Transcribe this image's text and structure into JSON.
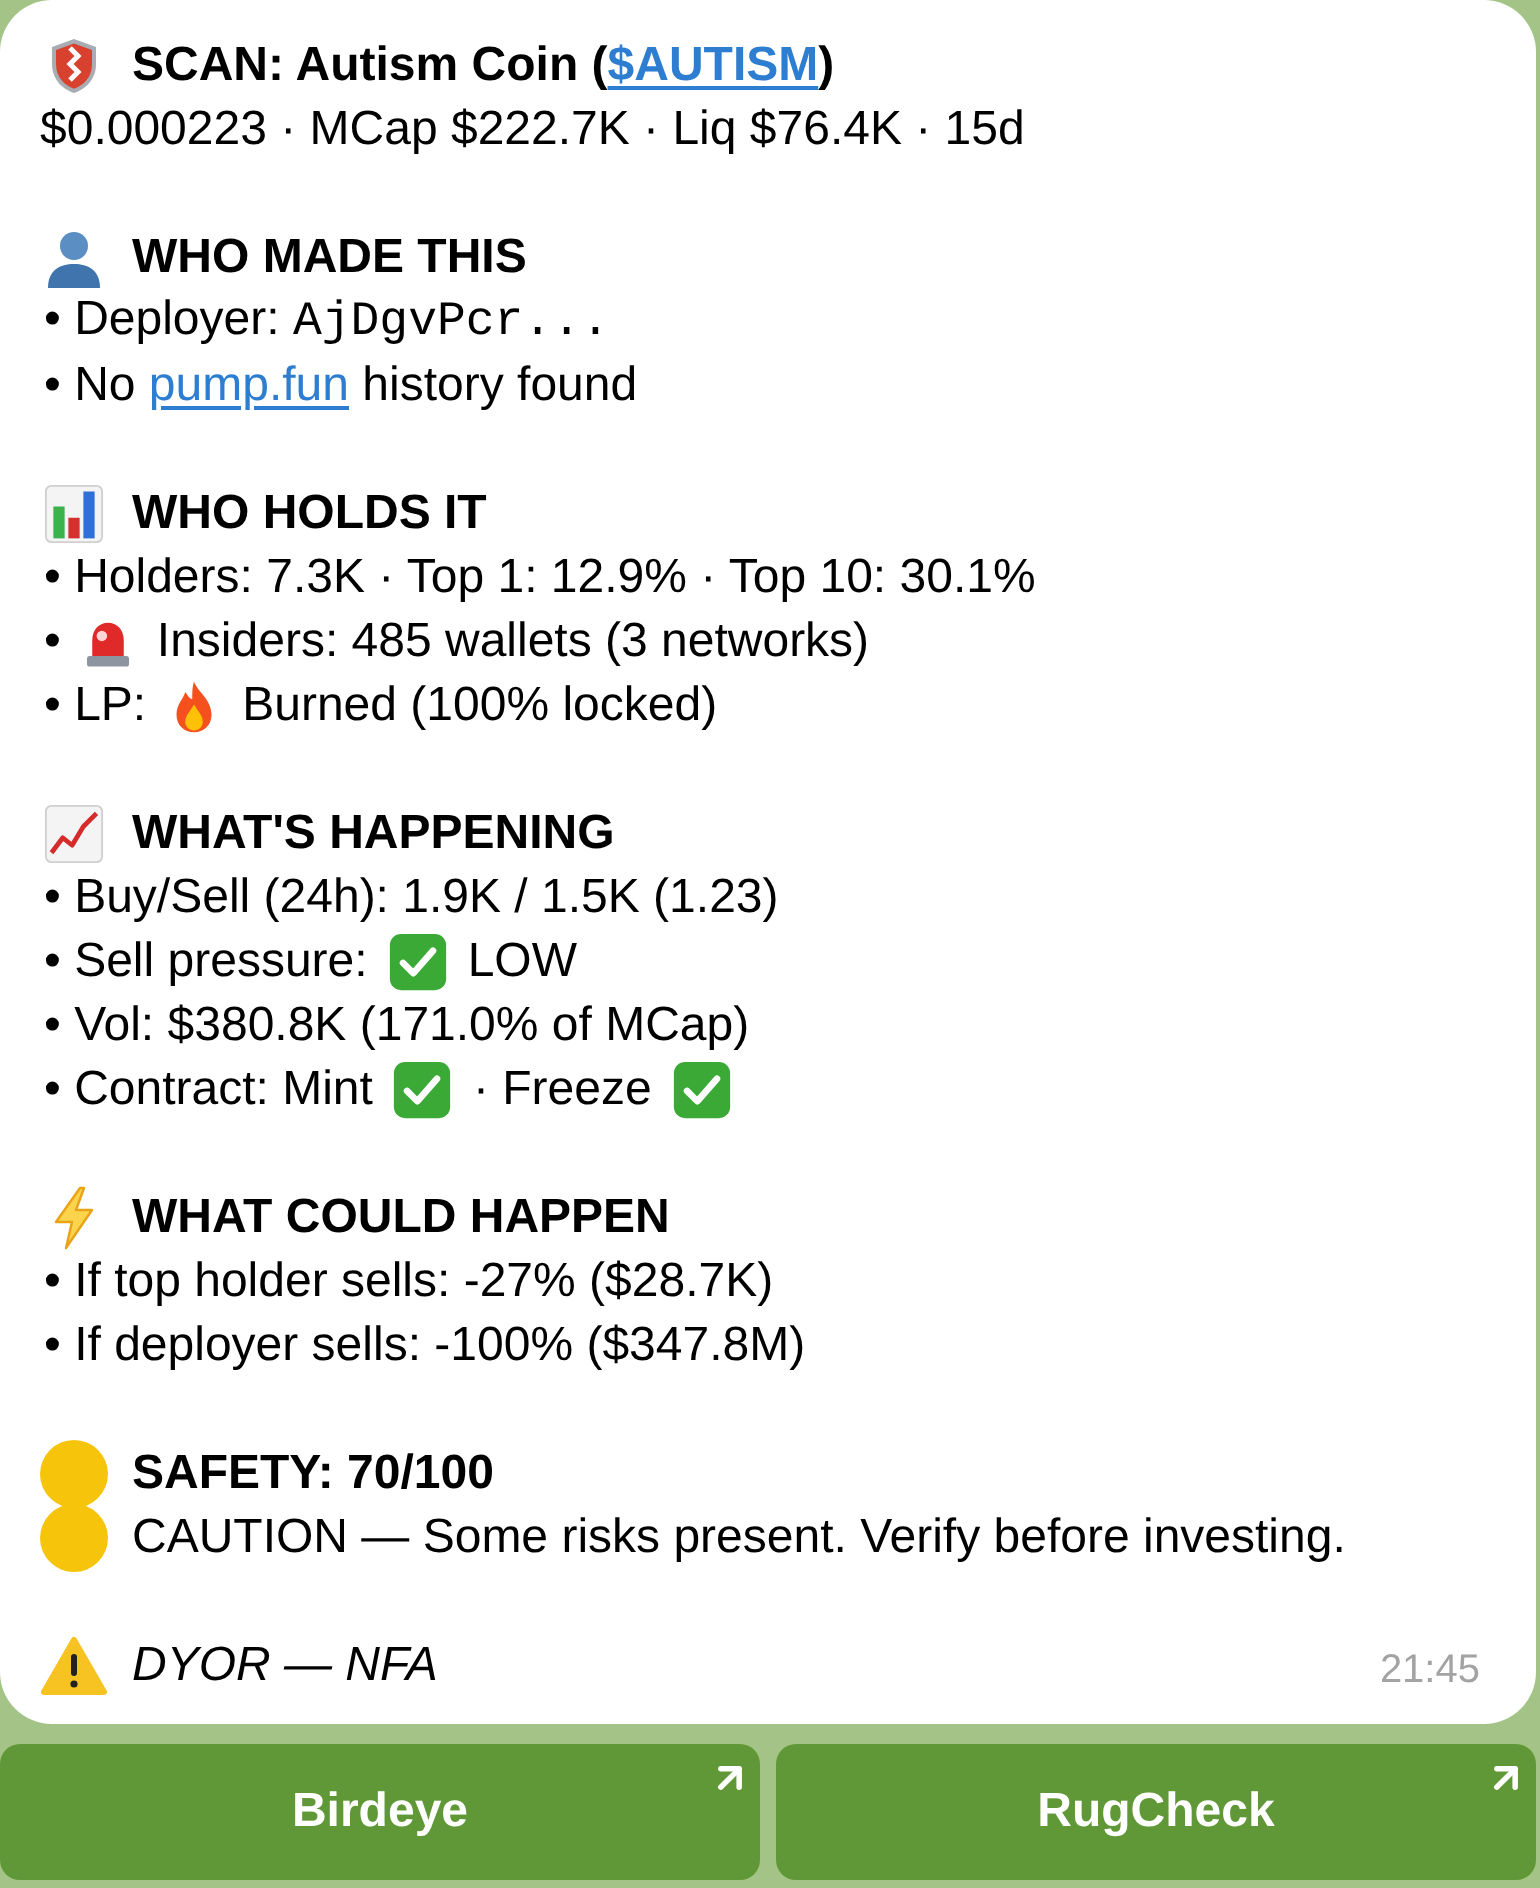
{
  "message": {
    "header": {
      "kind": "scan",
      "title": [
        {
          "kind": "text",
          "text": "SCAN: Autism Coin ("
        },
        {
          "kind": "link",
          "text": "$AUTISM"
        },
        {
          "kind": "text",
          "text": ")"
        }
      ],
      "stats": "$0.000223 · MCap $222.7K · Liq $76.4K · 15d"
    },
    "sections": [
      {
        "kind": "creator",
        "heading": "WHO MADE THIS",
        "lines": [
          [
            {
              "kind": "text",
              "text": "• Deployer: "
            },
            {
              "kind": "code",
              "text": "AjDgvPcr..."
            }
          ],
          [
            {
              "kind": "text",
              "text": "• No "
            },
            {
              "kind": "link",
              "text": "pump.fun"
            },
            {
              "kind": "text",
              "text": " history found"
            }
          ]
        ]
      },
      {
        "kind": "holders",
        "heading": "WHO HOLDS IT",
        "lines": [
          [
            {
              "kind": "text",
              "text": "• Holders: 7.3K · Top 1: 12.9% · Top 10: 30.1%"
            }
          ],
          [
            {
              "kind": "text",
              "text": "•"
            },
            {
              "kind": "alert"
            },
            {
              "kind": "text",
              "text": "Insiders: 485 wallets (3 networks)"
            }
          ],
          [
            {
              "kind": "text",
              "text": "• LP:"
            },
            {
              "kind": "burn"
            },
            {
              "kind": "text",
              "text": "Burned (100% locked)"
            }
          ]
        ]
      },
      {
        "kind": "activity",
        "heading": "WHAT'S HAPPENING",
        "lines": [
          [
            {
              "kind": "text",
              "text": "• Buy/Sell (24h): 1.9K / 1.5K (1.23)"
            }
          ],
          [
            {
              "kind": "text",
              "text": "• Sell pressure:"
            },
            {
              "kind": "ok"
            },
            {
              "kind": "text",
              "text": "LOW"
            }
          ],
          [
            {
              "kind": "text",
              "text": "• Vol: $380.8K (171.0% of MCap)"
            }
          ],
          [
            {
              "kind": "text",
              "text": "• Contract: Mint"
            },
            {
              "kind": "ok"
            },
            {
              "kind": "text",
              "text": "· Freeze"
            },
            {
              "kind": "ok"
            }
          ]
        ]
      },
      {
        "kind": "risk",
        "heading": "WHAT COULD HAPPEN",
        "lines": [
          [
            {
              "kind": "text",
              "text": "• If top holder sells: -27% ($28.7K)"
            }
          ],
          [
            {
              "kind": "text",
              "text": "• If deployer sells: -100% ($347.8M)"
            }
          ]
        ]
      },
      {
        "kind": "safety",
        "color": "#f7c40c",
        "heading": "SAFETY: 70/100",
        "lines": [
          [
            {
              "kind": "status"
            },
            {
              "kind": "text",
              "text": "CAUTION — Some risks present. Verify before investing."
            }
          ]
        ]
      }
    ],
    "footer": {
      "kind": "warning",
      "text": "DYOR — NFA"
    },
    "time": "21:45"
  },
  "buttons": [
    {
      "label": "Birdeye"
    },
    {
      "label": "RugCheck"
    }
  ]
}
